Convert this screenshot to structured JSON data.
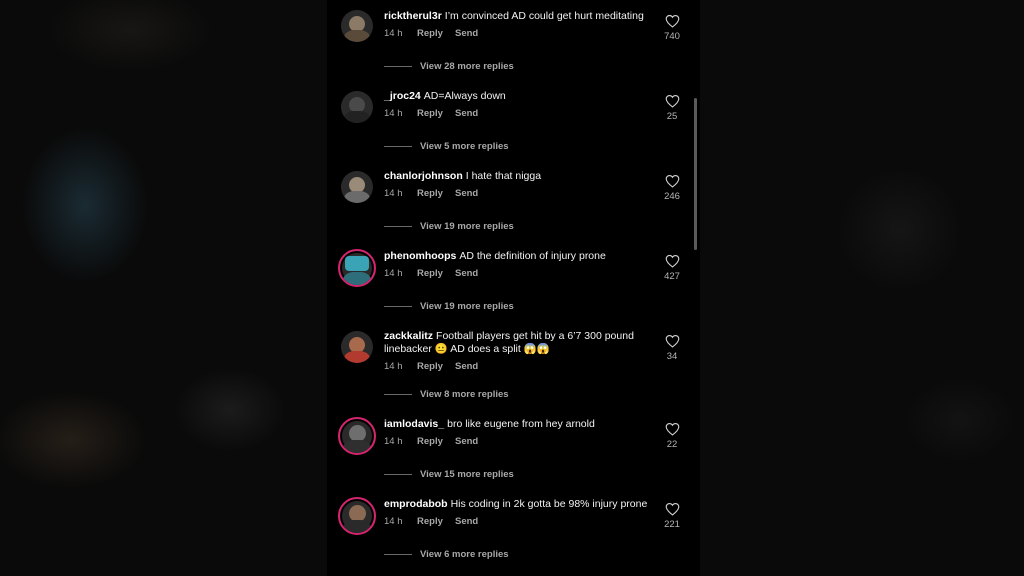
{
  "comments": [
    {
      "username": "ricktherul3r",
      "text": "I’m convinced AD could get hurt meditating",
      "time": "14 h",
      "reply": "Reply",
      "send": "Send",
      "likes": "740",
      "more": "View 28 more replies"
    },
    {
      "username": "_jroc24",
      "text": "AD=Always down",
      "time": "14 h",
      "reply": "Reply",
      "send": "Send",
      "likes": "25",
      "more": "View 5 more replies"
    },
    {
      "username": "chanlorjohnson",
      "text": "I hate that nigga",
      "time": "14 h",
      "reply": "Reply",
      "send": "Send",
      "likes": "246",
      "more": "View 19 more replies"
    },
    {
      "username": "phenomhoops",
      "text": "AD the definition of injury prone",
      "time": "14 h",
      "reply": "Reply",
      "send": "Send",
      "likes": "427",
      "more": "View 19 more replies"
    },
    {
      "username": "zackkalitz",
      "text": "Football players get hit by a 6’7 300 pound linebacker 😐 AD does a split 😱😱",
      "time": "14 h",
      "reply": "Reply",
      "send": "Send",
      "likes": "34",
      "more": "View 8 more replies"
    },
    {
      "username": "iamlodavis_",
      "text": "bro like eugene from hey arnold",
      "time": "14 h",
      "reply": "Reply",
      "send": "Send",
      "likes": "22",
      "more": "View 15 more replies"
    },
    {
      "username": "emprodabob",
      "text": "His coding in 2k gotta be 98% injury prone",
      "time": "14 h",
      "reply": "Reply",
      "send": "Send",
      "likes": "221",
      "more": "View 6 more replies"
    }
  ],
  "colors": {
    "ring": "#d6246e",
    "panel": "#000000",
    "text": "#f2f2f2",
    "muted": "#a8a8a8"
  },
  "icons": {
    "like": "heart-icon"
  }
}
